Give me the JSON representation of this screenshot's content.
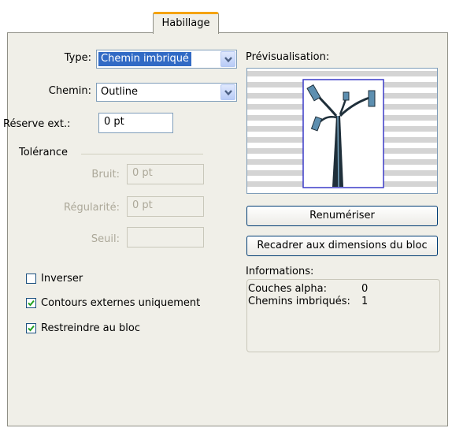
{
  "tab": {
    "label": "Habillage"
  },
  "left": {
    "type_label": "Type:",
    "type_value": "Chemin imbriqué",
    "path_label": "Chemin:",
    "path_value": "Outline",
    "outset_label": "Réserve ext.:",
    "outset_value": "0 pt",
    "tolerance_label": "Tolérance",
    "noise_label": "Bruit:",
    "noise_value": "0 pt",
    "smoothness_label": "Régularité:",
    "smoothness_value": "0 pt",
    "threshold_label": "Seuil:",
    "threshold_value": ""
  },
  "checkboxes": [
    {
      "label": "Inverser",
      "checked": false
    },
    {
      "label": "Contours externes uniquement",
      "checked": true
    },
    {
      "label": "Restreindre au bloc",
      "checked": true
    }
  ],
  "right": {
    "preview_label": "Prévisualisation:",
    "rescan_label": "Renumériser",
    "crop_label": "Recadrer aux dimensions du bloc",
    "info_label": "Informations:",
    "alpha_label": "Couches alpha:",
    "alpha_value": "0",
    "paths_label": "Chemins imbriqués:",
    "paths_value": "1"
  },
  "colors": {
    "tab_accent": "#f5a300",
    "selection": "#316ac5",
    "check": "#21a121",
    "preview_frame": "#3c3cc8",
    "preview_stripes": "#d4d4d4"
  },
  "icons": [
    "chevron-down-icon",
    "checkmark-icon"
  ]
}
